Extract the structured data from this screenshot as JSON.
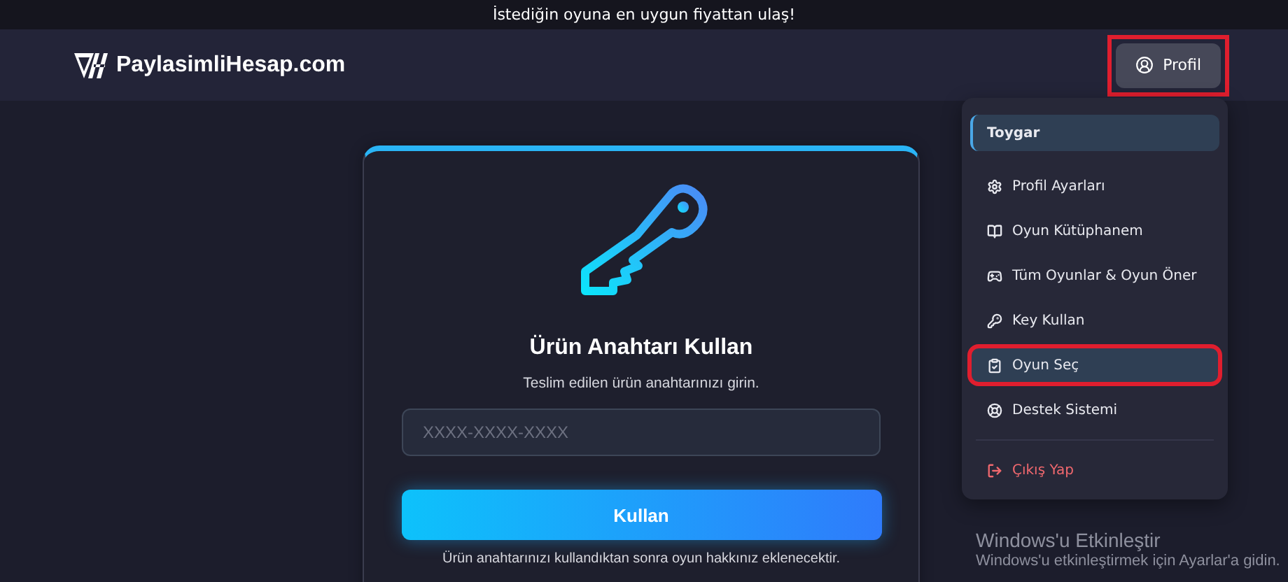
{
  "announcement": "İstediğin oyuna en uygun fiyattan ulaş!",
  "header": {
    "logo": "PaylasimliHesap.com",
    "profile_button": {
      "label": "Profil",
      "annotated": true
    }
  },
  "profile_menu": {
    "items": [
      {
        "kind": "user",
        "label": "Toygar"
      },
      {
        "kind": "settings",
        "label": "Profil Ayarları",
        "selected": false,
        "annotated": false
      },
      {
        "kind": "library",
        "label": "Oyun Kütüphanem",
        "selected": false,
        "annotated": false
      },
      {
        "kind": "games",
        "label": "Tüm Oyunlar & Oyun Öner",
        "selected": false,
        "annotated": false
      },
      {
        "kind": "key",
        "label": "Key Kullan",
        "selected": false,
        "annotated": false
      },
      {
        "kind": "pick",
        "label": "Oyun Seç",
        "selected": true,
        "annotated": true
      },
      {
        "kind": "support",
        "label": "Destek Sistemi",
        "selected": false,
        "annotated": false
      },
      {
        "kind": "logout",
        "label": "Çıkış Yap",
        "selected": false,
        "annotated": false
      }
    ]
  },
  "redeem_card": {
    "title": "Ürün Anahtarı Kullan",
    "subtitle": "Teslim edilen ürün anahtarınızı girin.",
    "input": {
      "placeholder": "XXXX-XXXX-XXXX"
    },
    "button": "Kullan",
    "note": "Ürün anahtarınızı kullandıktan sonra oyun hakkınız eklenecektir."
  },
  "os_notice": {
    "title": "Windows'u Etkinleştir",
    "text": "Windows'u etkinleştirmek için Ayarlar'a gidin."
  }
}
